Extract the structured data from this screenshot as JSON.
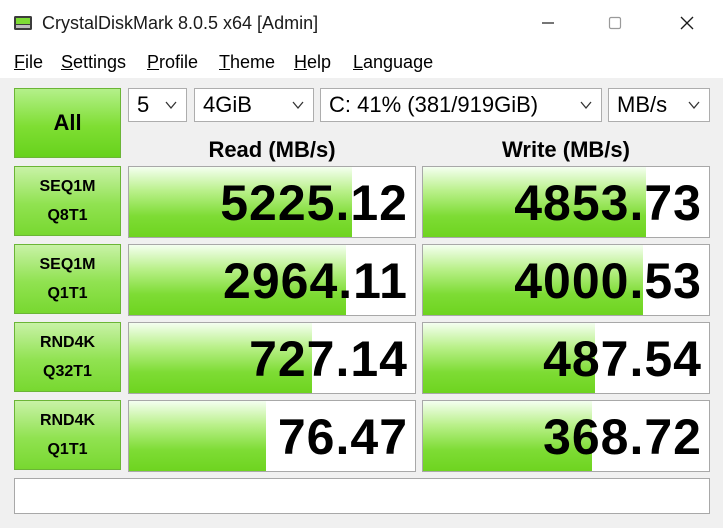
{
  "window": {
    "title": "CrystalDiskMark 8.0.5 x64 [Admin]",
    "app_icon": "disk-icon",
    "controls": [
      "minimize-icon",
      "maximize-icon",
      "close-icon"
    ]
  },
  "menu": {
    "items": [
      {
        "accel": "F",
        "rest": "ile"
      },
      {
        "accel": "S",
        "rest": "ettings"
      },
      {
        "accel": "P",
        "rest": "rofile"
      },
      {
        "accel": "T",
        "rest": "heme"
      },
      {
        "accel": "H",
        "rest": "elp"
      },
      {
        "accel": "L",
        "rest": "anguage"
      }
    ]
  },
  "controls": {
    "all_label": "All",
    "count": "5",
    "size": "4GiB",
    "drive": "C: 41% (381/919GiB)",
    "unit": "MB/s"
  },
  "headers": {
    "read": "Read (MB/s)",
    "write": "Write (MB/s)"
  },
  "tests": [
    {
      "line1": "SEQ1M",
      "line2": "Q8T1",
      "read": "5225.12",
      "write": "4853.73",
      "read_fill_pct": 78,
      "write_fill_pct": 78
    },
    {
      "line1": "SEQ1M",
      "line2": "Q1T1",
      "read": "2964.11",
      "write": "4000.53",
      "read_fill_pct": 76,
      "write_fill_pct": 77
    },
    {
      "line1": "RND4K",
      "line2": "Q32T1",
      "read": "727.14",
      "write": "487.54",
      "read_fill_pct": 64,
      "write_fill_pct": 60
    },
    {
      "line1": "RND4K",
      "line2": "Q1T1",
      "read": "76.47",
      "write": "368.72",
      "read_fill_pct": 48,
      "write_fill_pct": 59
    }
  ],
  "comment": "",
  "colors": {
    "accent_green": "#7edc35",
    "border": "#a8a8a8",
    "background": "#f0f0f0"
  }
}
